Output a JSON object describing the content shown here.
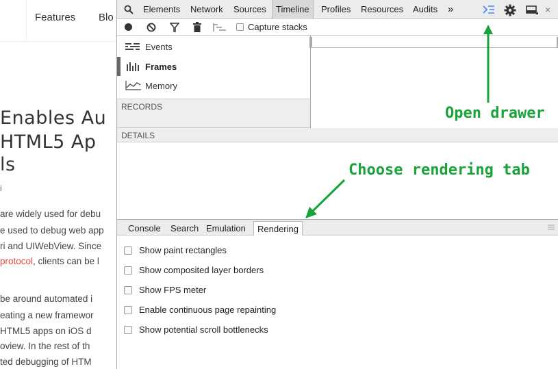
{
  "background_page": {
    "nav_items": [
      "Features",
      "Blo"
    ],
    "headline_lines": [
      "Enables Au",
      "HTML5 Ap",
      "ls"
    ],
    "byline": "i",
    "paragraph1": [
      "are widely used for debu",
      "e used to debug web app",
      "ri and UIWebView. Since"
    ],
    "paragraph1_link_prefix": "protocol",
    "paragraph1_link_suffix": ", clients can be l",
    "paragraph2": [
      "be around automated i",
      "eating a new framewor",
      "HTML5 apps on iOS d",
      "oview. In the rest of th",
      "ted debugging of HTM"
    ]
  },
  "devtools": {
    "tabs": [
      "Elements",
      "Network",
      "Sources",
      "Timeline",
      "Profiles",
      "Resources",
      "Audits"
    ],
    "active_tab": "Timeline",
    "more_tabs": "»",
    "capture_stacks_label": "Capture stacks",
    "side_items": [
      "Events",
      "Frames",
      "Memory"
    ],
    "selected_side_item": "Frames",
    "records_label": "RECORDS",
    "details_label": "DETAILS",
    "drawer_tabs": [
      "Console",
      "Search",
      "Emulation",
      "Rendering"
    ],
    "active_drawer_tab": "Rendering",
    "rendering_options": [
      "Show paint rectangles",
      "Show composited layer borders",
      "Show FPS meter",
      "Enable continuous page repainting",
      "Show potential scroll bottlenecks"
    ],
    "close_glyph": "×"
  },
  "annotations": {
    "open_drawer": "Open drawer",
    "choose_rendering": "Choose rendering tab"
  },
  "colors": {
    "annotation_green": "#1aa33a",
    "drawer_icon_blue": "#4a8cf7",
    "link_red": "#e04b3a"
  }
}
